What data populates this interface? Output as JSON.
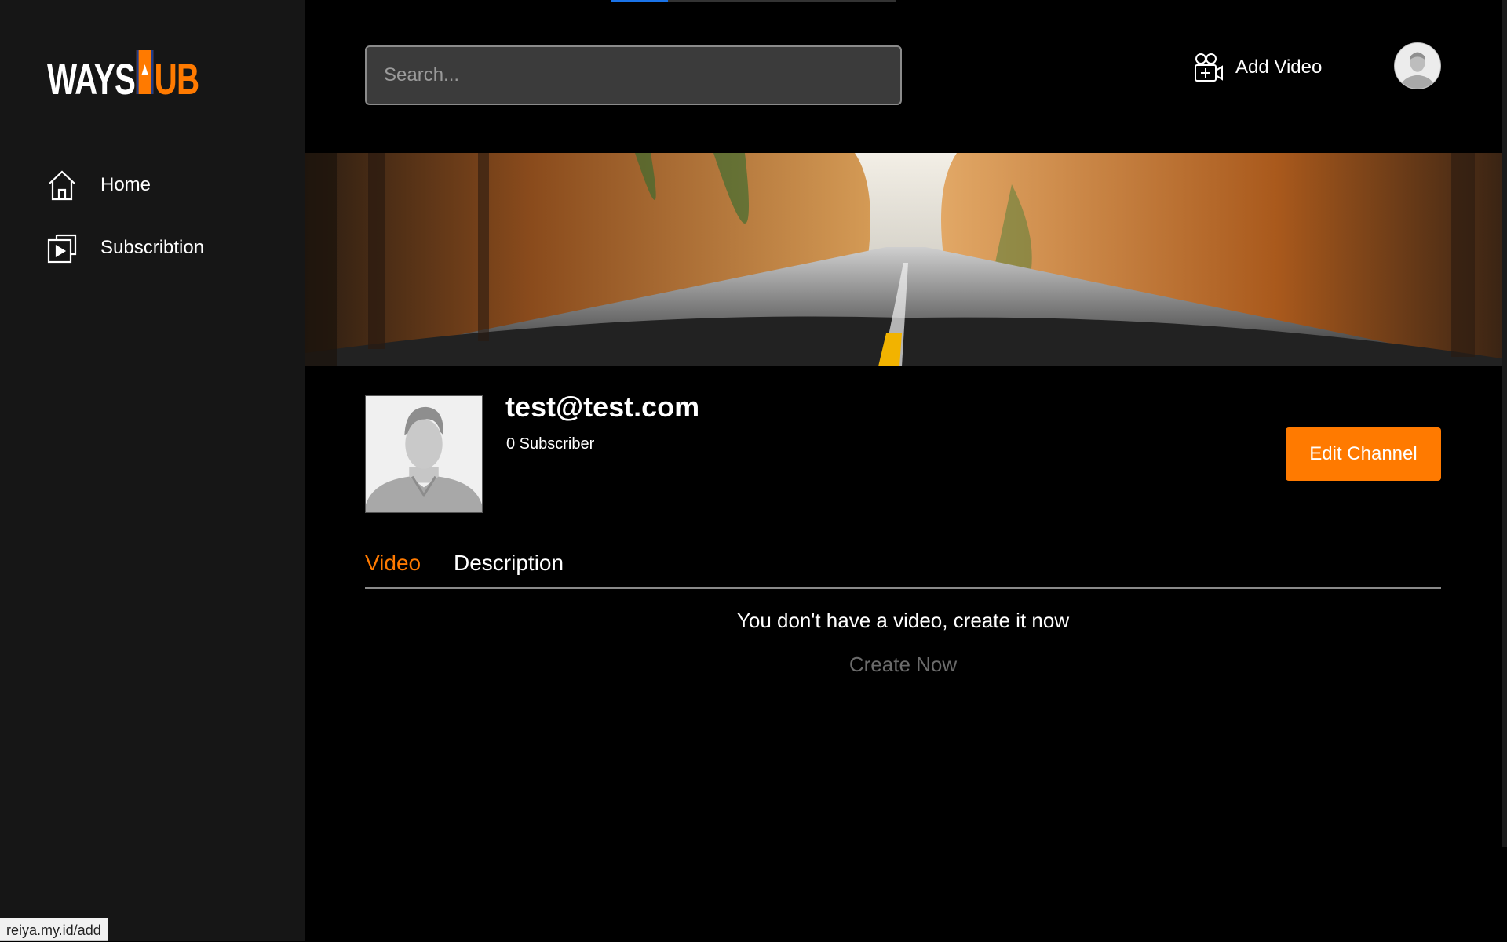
{
  "sidebar": {
    "logo": {
      "part1": "WAYS",
      "part2": "UB",
      "icon": "film-play-icon"
    },
    "items": [
      {
        "label": "Home",
        "icon": "home-icon"
      },
      {
        "label": "Subscribtion",
        "icon": "subscription-icon"
      }
    ]
  },
  "header": {
    "search_placeholder": "Search...",
    "add_video_label": "Add Video",
    "add_video_icon": "camera-plus-icon",
    "avatar_icon": "user-avatar-icon"
  },
  "channel": {
    "name": "test@test.com",
    "subscribers": "0 Subscriber",
    "edit_label": "Edit Channel"
  },
  "tabs": [
    {
      "label": "Video",
      "active": true
    },
    {
      "label": "Description",
      "active": false
    }
  ],
  "empty": {
    "message": "You don't have a video, create it now",
    "action": "Create Now"
  },
  "status_bar": {
    "url": "reiya.my.id/add"
  },
  "colors": {
    "accent": "#ff7a00",
    "sidebar_bg": "#161616",
    "page_bg": "#000000"
  }
}
